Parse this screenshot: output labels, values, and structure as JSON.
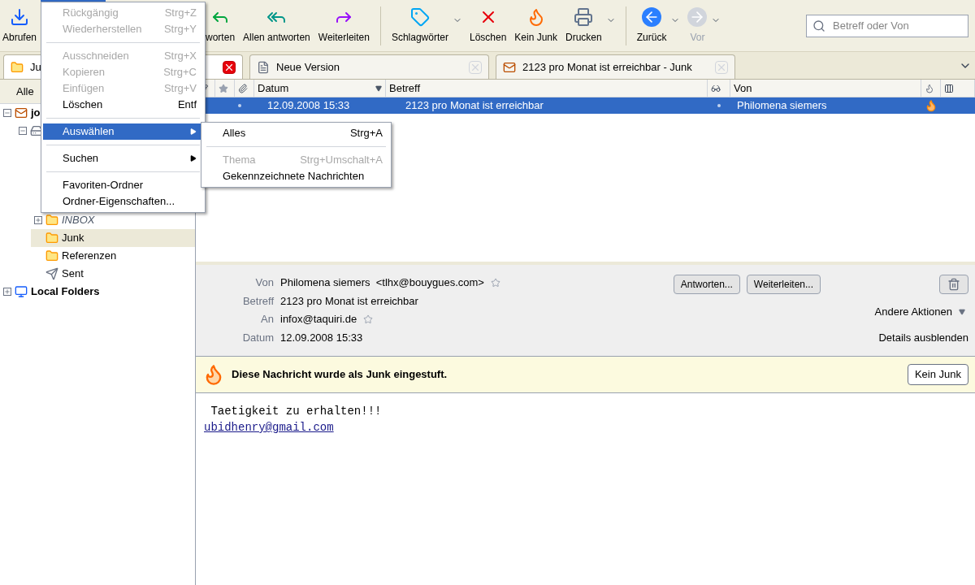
{
  "toolbar": {
    "items": [
      {
        "kind": "button",
        "label": "Abrufen",
        "dropdown": false,
        "disabled": false
      },
      {
        "kind": "gap"
      },
      {
        "kind": "button",
        "label": "worten",
        "dropdown": false,
        "disabled": false
      },
      {
        "kind": "button",
        "label": "Allen antworten",
        "dropdown": false,
        "disabled": false
      },
      {
        "kind": "button",
        "label": "Weiterleiten",
        "dropdown": false,
        "disabled": false
      },
      {
        "kind": "separator"
      },
      {
        "kind": "button",
        "label": "Schlagwörter",
        "dropdown": true,
        "disabled": false
      },
      {
        "kind": "button",
        "label": "Löschen",
        "dropdown": false,
        "disabled": false
      },
      {
        "kind": "button",
        "label": "Kein Junk",
        "dropdown": false,
        "disabled": false
      },
      {
        "kind": "button",
        "label": "Drucken",
        "dropdown": true,
        "disabled": false
      },
      {
        "kind": "separator"
      },
      {
        "kind": "button",
        "label": "Zurück",
        "dropdown": true,
        "disabled": false
      },
      {
        "kind": "button",
        "label": "Vor",
        "dropdown": true,
        "disabled": true
      }
    ],
    "search": {
      "placeholder": "Betreff oder Von"
    }
  },
  "tabs": [
    {
      "label": "Ju",
      "selected": true
    },
    {
      "label": "Neue Version",
      "selected": false
    },
    {
      "label": "2123 pro Monat ist erreichbar - Junk",
      "selected": false
    }
  ],
  "folder_pane": {
    "header": "Alle",
    "tree": [
      {
        "label": "jo",
        "bold": true,
        "italic": false,
        "expanded": true,
        "selected": false,
        "children": [
          {
            "expanded": true,
            "selected": false,
            "children": [
              {
                "label": "INBOX",
                "bold": false,
                "italic": true,
                "expanded": false,
                "selected": false
              },
              {
                "label": "Junk",
                "bold": false,
                "italic": false,
                "selected": true
              },
              {
                "label": "Referenzen",
                "bold": false,
                "italic": false,
                "selected": false
              },
              {
                "label": "Sent",
                "bold": false,
                "italic": false,
                "selected": false
              }
            ]
          }
        ]
      },
      {
        "label": "Local Folders",
        "bold": true,
        "italic": false,
        "expanded": false,
        "selected": false
      }
    ]
  },
  "thread_pane": {
    "columns": [
      {
        "kind": "thread"
      },
      {
        "kind": "star"
      },
      {
        "kind": "attachment"
      },
      {
        "kind": "text",
        "label": "Datum",
        "sorted": true
      },
      {
        "kind": "text",
        "label": "Betreff",
        "sorted": false
      },
      {
        "kind": "read"
      },
      {
        "kind": "text",
        "label": "Von",
        "sorted": false
      },
      {
        "kind": "junk"
      },
      {
        "kind": "picker"
      }
    ],
    "rows": [
      {
        "date": "12.09.2008 15:33",
        "subject": "2123 pro Monat ist erreichbar",
        "from": "Philomena siemers",
        "selected": true,
        "junk": true
      }
    ]
  },
  "message": {
    "fields": [
      {
        "label": "Von",
        "value": "Philomena siemers  <tlhx@bouygues.com>",
        "star": true
      },
      {
        "label": "Betreff",
        "value": "2123 pro Monat ist erreichbar",
        "star": false
      },
      {
        "label": "An",
        "value": "infox@taquiri.de",
        "star": true
      },
      {
        "label": "Datum",
        "value": "12.09.2008 15:33",
        "star": false
      }
    ],
    "buttons": [
      "Antworten...",
      "Weiterleiten..."
    ],
    "other_actions": "Andere Aktionen",
    "details_toggle": "Details ausblenden",
    "junk_bar": {
      "text": "Diese Nachricht wurde als Junk eingestuft.",
      "button": "Kein Junk"
    },
    "body": {
      "text": " Taetigkeit zu erhalten!!!",
      "link": "ubidhenry@gmail.com"
    }
  },
  "edit_menu": {
    "items": [
      {
        "kind": "item",
        "label": "Rückgängig",
        "shortcut": "Strg+Z",
        "disabled": true,
        "selected": false
      },
      {
        "kind": "item",
        "label": "Wiederherstellen",
        "shortcut": "Strg+Y",
        "disabled": true,
        "selected": false
      },
      {
        "kind": "separator"
      },
      {
        "kind": "item",
        "label": "Ausschneiden",
        "shortcut": "Strg+X",
        "disabled": true,
        "selected": false
      },
      {
        "kind": "item",
        "label": "Kopieren",
        "shortcut": "Strg+C",
        "disabled": true,
        "selected": false
      },
      {
        "kind": "item",
        "label": "Einfügen",
        "shortcut": "Strg+V",
        "disabled": true,
        "selected": false
      },
      {
        "kind": "item",
        "label": "Löschen",
        "shortcut": "Entf",
        "disabled": false,
        "selected": false
      },
      {
        "kind": "separator"
      },
      {
        "kind": "submenu",
        "label": "Auswählen",
        "disabled": false,
        "selected": true
      },
      {
        "kind": "separator"
      },
      {
        "kind": "submenu",
        "label": "Suchen",
        "disabled": false,
        "selected": false
      },
      {
        "kind": "separator"
      },
      {
        "kind": "item",
        "label": "Favoriten-Ordner",
        "disabled": false,
        "selected": false
      },
      {
        "kind": "item",
        "label": "Ordner-Eigenschaften...",
        "disabled": false,
        "selected": false
      }
    ]
  },
  "select_submenu": {
    "items": [
      {
        "kind": "item",
        "label": "Alles",
        "shortcut": "Strg+A",
        "disabled": false,
        "selected": false
      },
      {
        "kind": "separator"
      },
      {
        "kind": "item",
        "label": "Thema",
        "shortcut": "Strg+Umschalt+A",
        "disabled": true,
        "selected": false
      },
      {
        "kind": "item",
        "label": "Gekennzeichnete Nachrichten",
        "disabled": false,
        "selected": false
      }
    ]
  }
}
